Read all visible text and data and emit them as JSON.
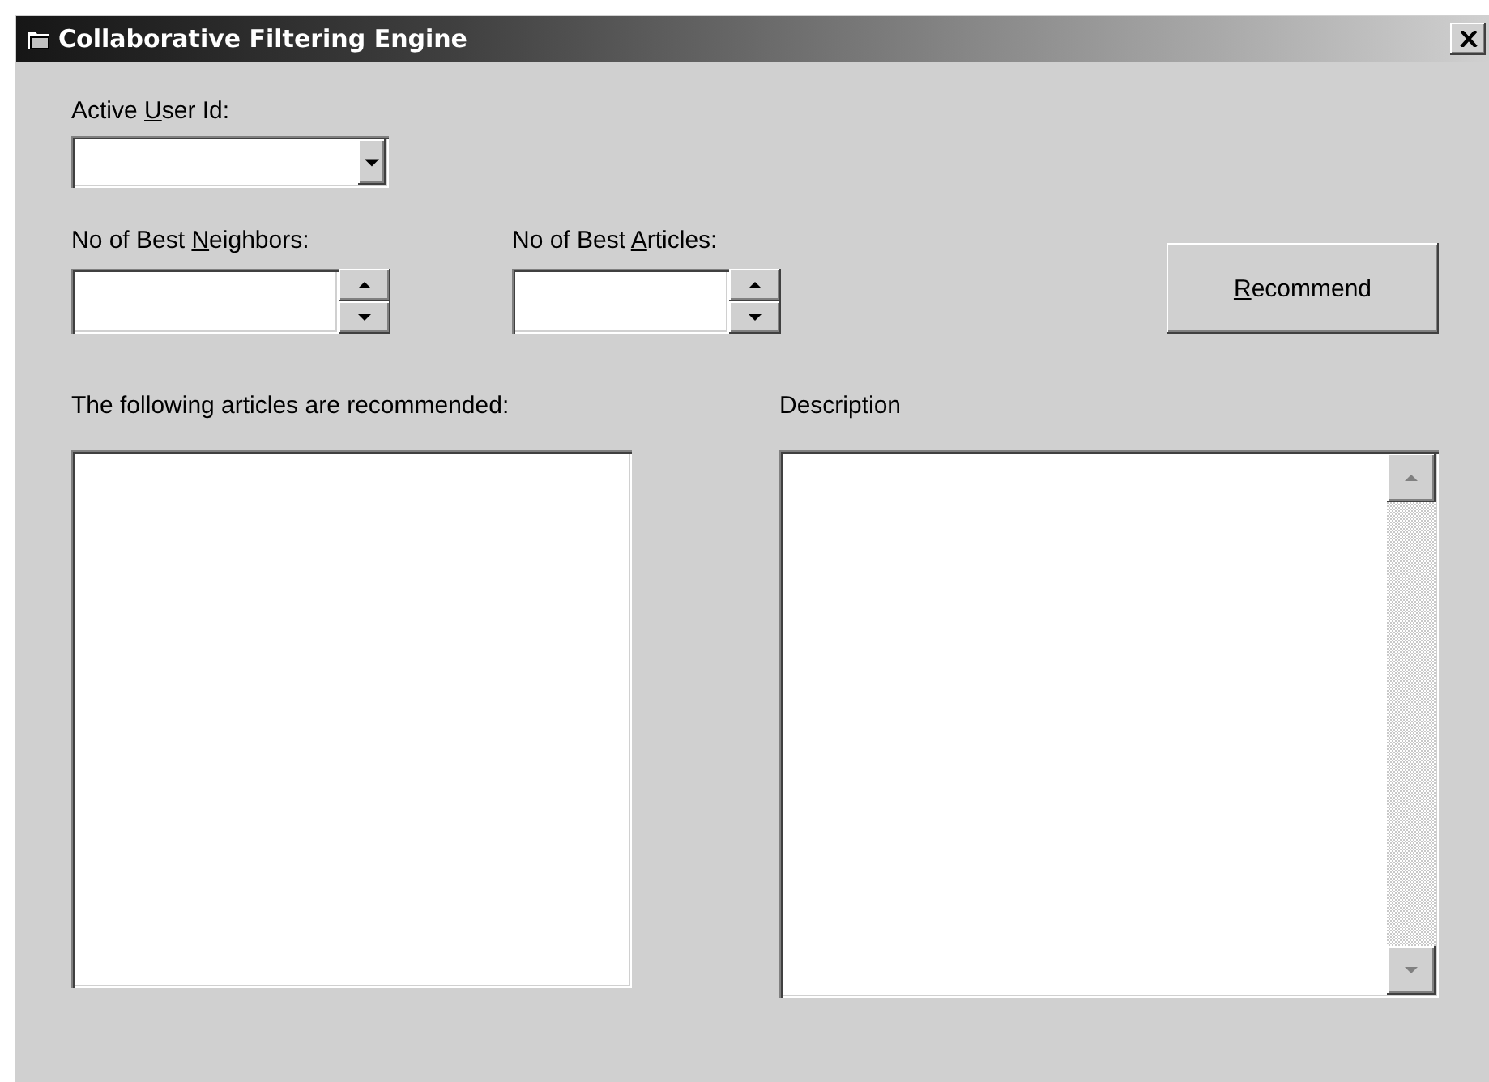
{
  "window": {
    "title": "Collaborative Filtering Engine"
  },
  "active_user": {
    "label": {
      "before": "Active ",
      "key": "U",
      "after": "ser Id:"
    }
  },
  "neighbors": {
    "label": {
      "before": "No of Best ",
      "key": "N",
      "after": "eighbors:"
    }
  },
  "articles": {
    "label": {
      "before": "No of Best ",
      "key": "A",
      "after": "rticles:"
    }
  },
  "recommend_button": {
    "label": {
      "key": "R",
      "after": "ecommend"
    }
  },
  "recommended_list": {
    "label": "The following articles are recommended:"
  },
  "description": {
    "label": "Description"
  }
}
